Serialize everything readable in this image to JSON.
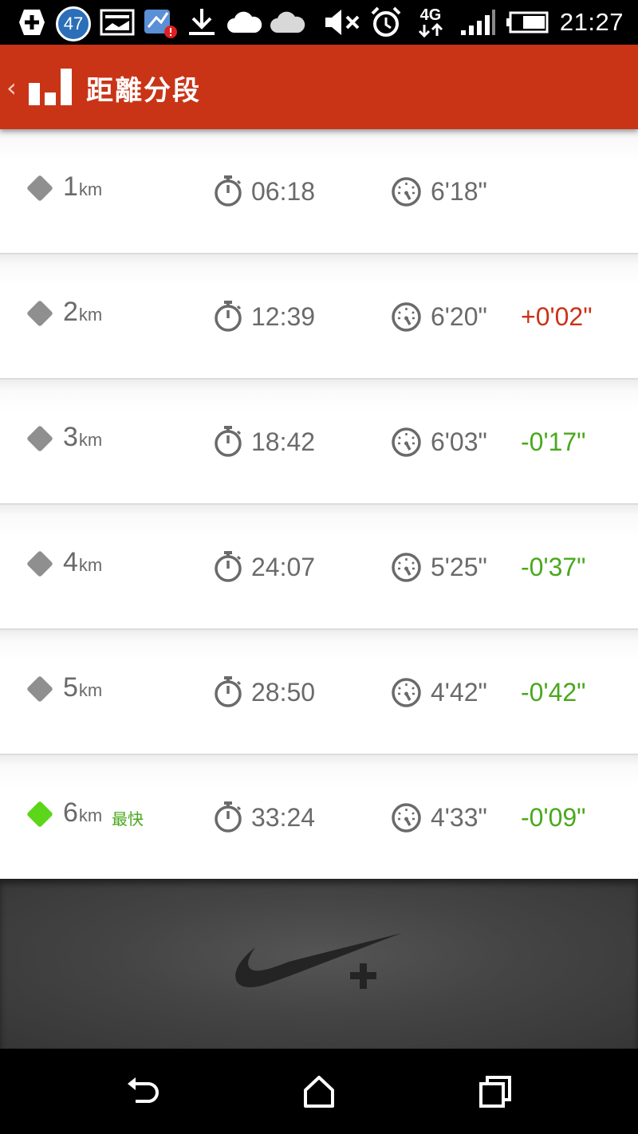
{
  "status_bar": {
    "notification_count": "47",
    "network_type": "4G",
    "time": "21:27",
    "icons": [
      "add-icon",
      "notification-count-icon",
      "image-icon",
      "app-alert-icon",
      "download-icon",
      "cloud-icon",
      "cloud-icon",
      "mute-icon",
      "alarm-icon",
      "network-4g-icon",
      "signal-icon",
      "battery-icon"
    ]
  },
  "action_bar": {
    "title": "距離分段",
    "color": "#c93417"
  },
  "splits": [
    {
      "distance": "1",
      "unit": "km",
      "time": "06:18",
      "pace": "6'18\"",
      "diff": "",
      "diff_type": "none",
      "fastest": false
    },
    {
      "distance": "2",
      "unit": "km",
      "time": "12:39",
      "pace": "6'20\"",
      "diff": "+0'02\"",
      "diff_type": "slower",
      "fastest": false
    },
    {
      "distance": "3",
      "unit": "km",
      "time": "18:42",
      "pace": "6'03\"",
      "diff": "-0'17\"",
      "diff_type": "faster",
      "fastest": false
    },
    {
      "distance": "4",
      "unit": "km",
      "time": "24:07",
      "pace": "5'25\"",
      "diff": "-0'37\"",
      "diff_type": "faster",
      "fastest": false
    },
    {
      "distance": "5",
      "unit": "km",
      "time": "28:50",
      "pace": "4'42\"",
      "diff": "-0'42\"",
      "diff_type": "faster",
      "fastest": false
    },
    {
      "distance": "6",
      "unit": "km",
      "time": "33:24",
      "pace": "4'33\"",
      "diff": "-0'09\"",
      "diff_type": "faster",
      "fastest": true
    }
  ],
  "fastest_label": "最快",
  "colors": {
    "slower": "#c93417",
    "faster": "#4aa81e",
    "fastest_marker": "#5cd61a",
    "marker": "#8f8f8f"
  },
  "footer": {
    "logo": "nike-plus-logo"
  },
  "nav_bar": {
    "buttons": [
      "back-icon",
      "home-icon",
      "recent-apps-icon"
    ]
  }
}
